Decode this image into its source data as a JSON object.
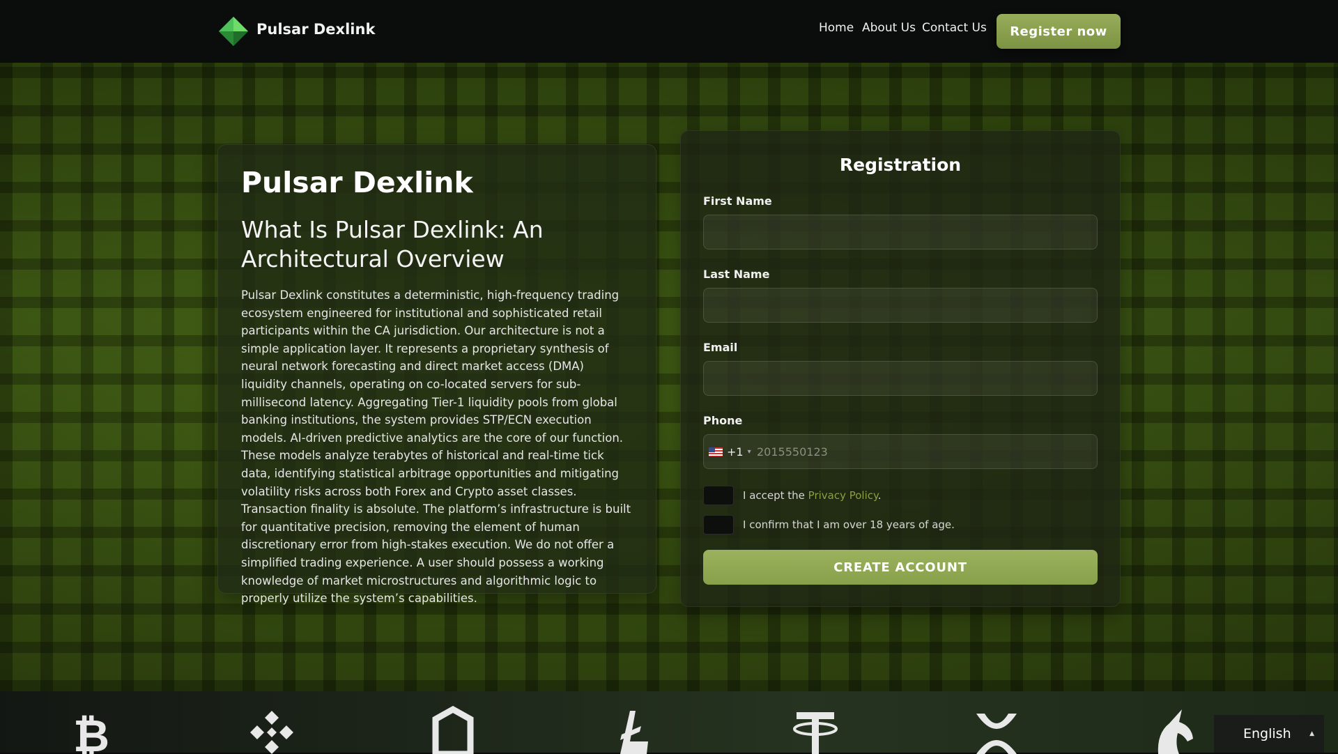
{
  "header": {
    "brand": "Pulsar Dexlink",
    "nav": [
      "Home",
      "About Us",
      "Contact Us"
    ],
    "cta_label": "Register now"
  },
  "about": {
    "title": "Pulsar Dexlink",
    "subtitle": "What Is Pulsar Dexlink: An Architectural Overview",
    "body": "Pulsar Dexlink constitutes a deterministic, high-frequency trading ecosystem engineered for institutional and sophisticated retail participants within the CA jurisdiction. Our architecture is not a simple application layer. It represents a proprietary synthesis of neural network forecasting and direct market access (DMA) liquidity channels, operating on co-located servers for sub-millisecond latency. Aggregating Tier-1 liquidity pools from global banking institutions, the system provides STP/ECN execution models. AI-driven predictive analytics are the core of our function. These models analyze terabytes of historical and real-time tick data, identifying statistical arbitrage opportunities and mitigating volatility risks across both Forex and Crypto asset classes. Transaction finality is absolute. The platform’s infrastructure is built for quantitative precision, removing the element of human discretionary error from high-stakes execution. We do not offer a simplified trading experience. A user should possess a working knowledge of market microstructures and algorithmic logic to properly utilize the system’s capabilities."
  },
  "form": {
    "title": "Registration",
    "first_name_label": "First Name",
    "last_name_label": "Last Name",
    "email_label": "Email",
    "phone_label": "Phone",
    "phone_code": "+1",
    "phone_placeholder": "2015550123",
    "privacy_prefix": "I accept the ",
    "privacy_link": "Privacy Policy",
    "privacy_suffix": ".",
    "age_confirm": "I confirm that I am over 18 years of age.",
    "submit_label": "CREATE ACCOUNT"
  },
  "crypto_strip": {
    "icons": [
      "bitcoin-icon",
      "binance-icon",
      "hexagon-coin-icon",
      "litecoin-icon",
      "tether-icon",
      "xrp-icon",
      "unicorn-icon"
    ]
  },
  "language": {
    "selected": "English"
  },
  "colors": {
    "accent": "#8ca34c",
    "header_bg": "#0b0c0c",
    "link": "#8aa044"
  }
}
